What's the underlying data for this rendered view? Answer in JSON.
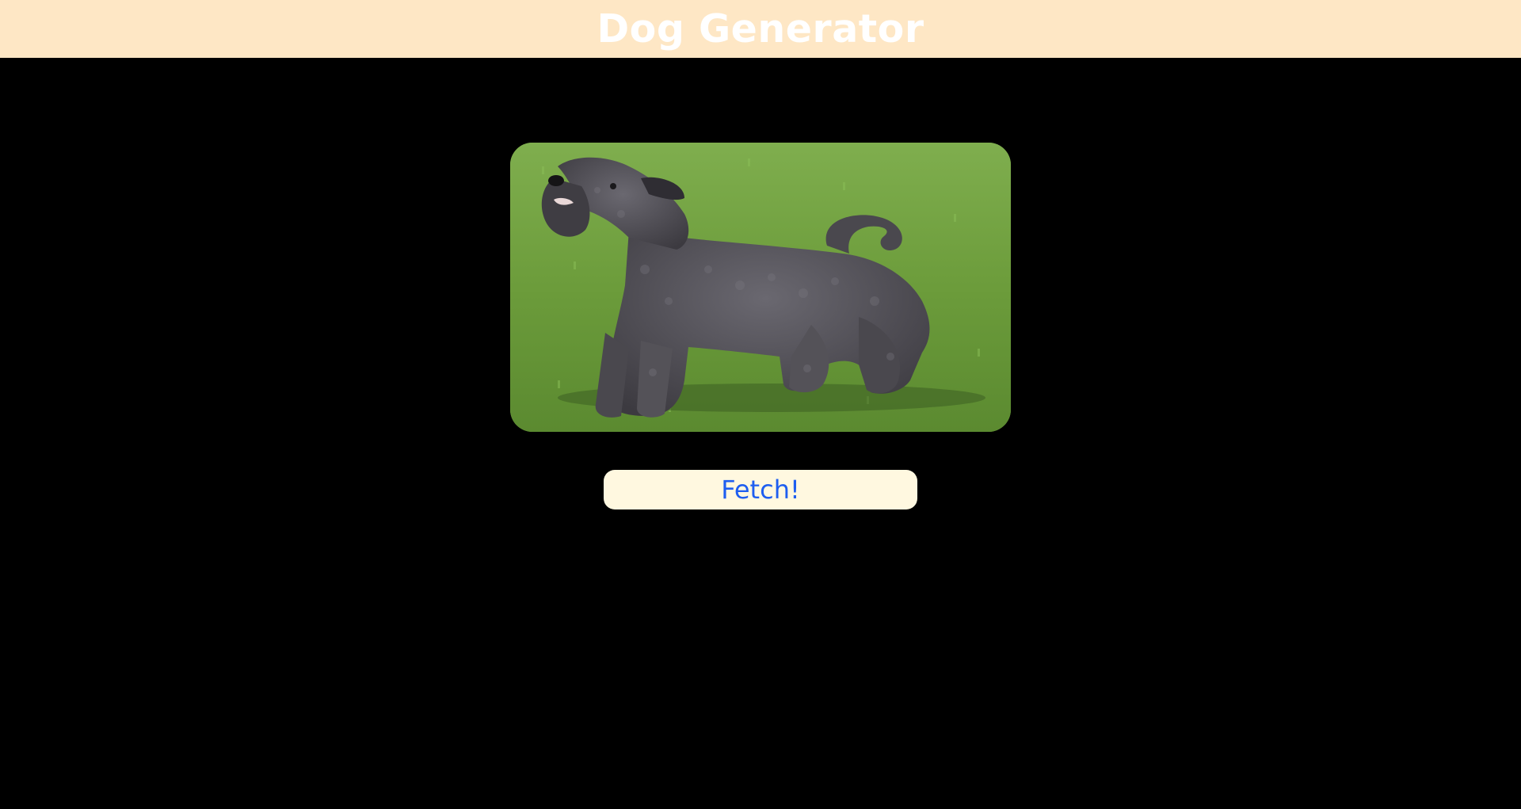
{
  "header": {
    "title": "Dog Generator"
  },
  "dog_image": {
    "subject": "dog-photo"
  },
  "fetch_button": {
    "label": "Fetch!"
  },
  "colors": {
    "page_background": "#000000",
    "header_background": "#fee7c5",
    "header_text": "#ffffff",
    "button_background": "#fff8e0",
    "button_text": "#1e5ef0"
  }
}
